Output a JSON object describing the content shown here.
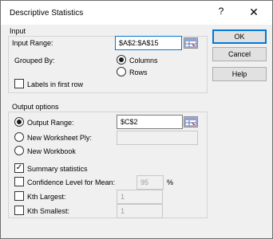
{
  "window": {
    "title": "Descriptive Statistics",
    "help_glyph": "?",
    "close_glyph": "✕"
  },
  "input": {
    "section_title": "Input",
    "input_range_label": "Input Range:",
    "input_range_value": "$A$2:$A$15",
    "grouped_by_label": "Grouped By:",
    "grouped_by_options": [
      "Columns",
      "Rows"
    ],
    "grouped_by_selected": "Columns",
    "labels_first_row": "Labels in first row",
    "labels_first_row_checked": false
  },
  "output": {
    "section_title": "Output options",
    "output_range_label": "Output Range:",
    "output_range_value": "$C$2",
    "new_worksheet_ply_label": "New Worksheet Ply:",
    "new_worksheet_ply_value": "",
    "new_workbook_label": "New Workbook",
    "selected_destination": "Output Range",
    "summary_statistics_label": "Summary statistics",
    "summary_statistics_checked": true,
    "confidence_label": "Confidence Level for Mean:",
    "confidence_value": "95",
    "confidence_unit": "%",
    "confidence_checked": false,
    "kth_largest_label": "Kth Largest:",
    "kth_largest_value": "1",
    "kth_largest_checked": false,
    "kth_smallest_label": "Kth Smallest:",
    "kth_smallest_value": "1",
    "kth_smallest_checked": false
  },
  "buttons": {
    "ok": "OK",
    "cancel": "Cancel",
    "help": "Help"
  },
  "icons": [
    "range-selector-icon",
    "help-icon",
    "close-icon",
    "checkmark-icon"
  ],
  "colors": {
    "focus_border": "#0078d7",
    "dialog_bg": "#f0f0f0"
  }
}
